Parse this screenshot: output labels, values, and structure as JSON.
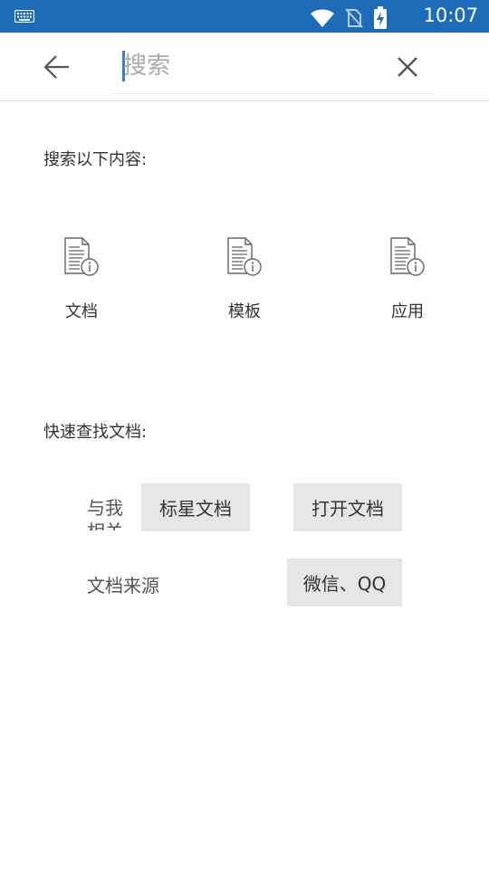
{
  "status_bar": {
    "time": "10:07",
    "icons": [
      "keyboard-icon",
      "wifi-icon",
      "no-sim-icon",
      "battery-charging-icon"
    ],
    "background": "#1e6bb8"
  },
  "search": {
    "placeholder": "搜索",
    "value": ""
  },
  "sections": {
    "search_scope_title": "搜索以下内容:",
    "quick_find_title": "快速查找文档:"
  },
  "categories": [
    {
      "label": "文档",
      "icon": "document-info-icon"
    },
    {
      "label": "模板",
      "icon": "document-info-icon"
    },
    {
      "label": "应用",
      "icon": "document-info-icon"
    }
  ],
  "quick_find": {
    "related_label": "与我相关",
    "source_label": "文档来源",
    "starred": "标星文档",
    "opened": "打开文档",
    "wechat_qq": "微信、QQ"
  },
  "colors": {
    "accent": "#3a7bd5",
    "chip_bg": "#e6e6e6"
  }
}
